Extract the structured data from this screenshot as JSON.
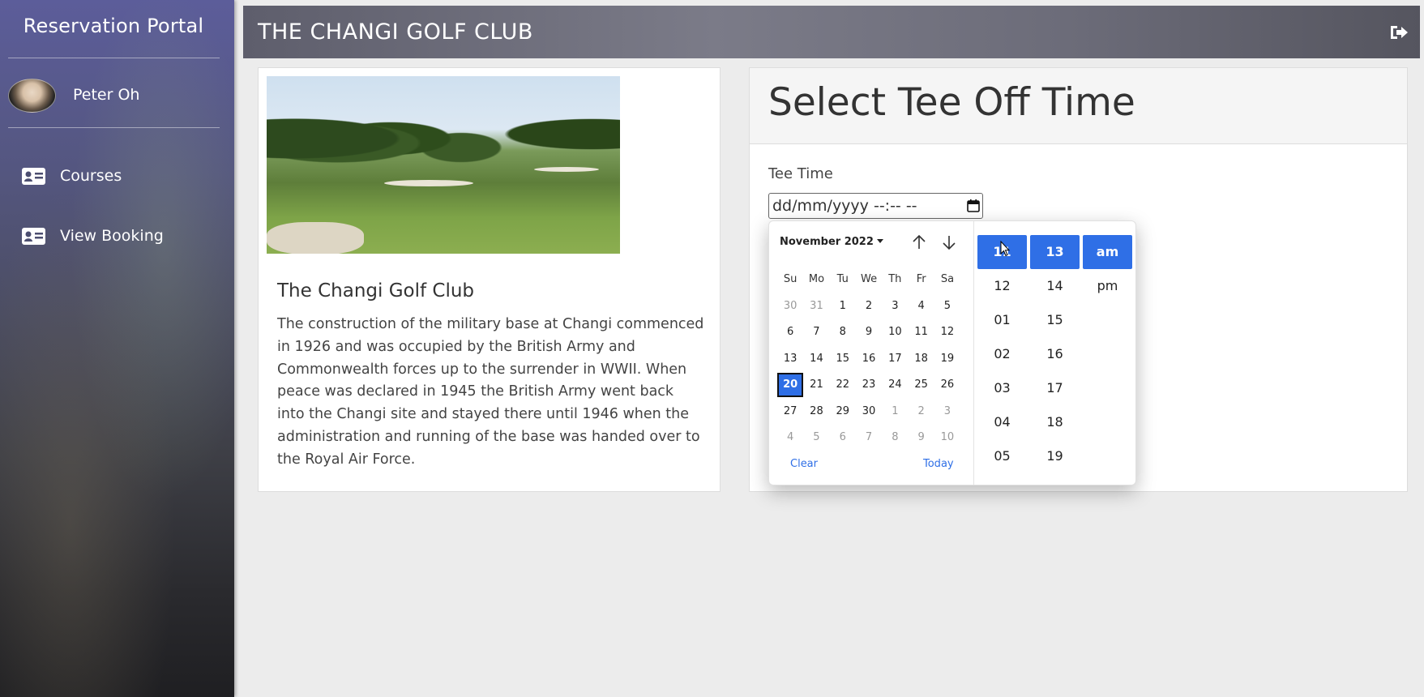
{
  "sidebar": {
    "brand": "Reservation Portal",
    "user": {
      "name": "Peter Oh"
    },
    "items": [
      {
        "label": "Courses",
        "icon": "id-card-icon"
      },
      {
        "label": "View Booking",
        "icon": "id-card-icon"
      }
    ]
  },
  "header": {
    "title": "THE CHANGI GOLF CLUB",
    "logout_icon": "sign-out-icon"
  },
  "course": {
    "name": "The Changi Golf Club",
    "description": "The construction of the military base at Changi commenced in 1926 and was occupied by the British Army and Commonwealth forces up to the surrender in WWII. When peace was declared in 1945 the British Army went back into the Changi site and stayed there until 1946 when the administration and running of the base was handed over to the Royal Air Force."
  },
  "booking": {
    "title": "Select Tee Off Time",
    "tee_time_label": "Tee Time",
    "input_value": "dd/mm/yyyy --:-- --"
  },
  "picker": {
    "month_label": "November 2022",
    "weekdays": [
      "Su",
      "Mo",
      "Tu",
      "We",
      "Th",
      "Fr",
      "Sa"
    ],
    "weeks": [
      [
        "30",
        "31",
        "1",
        "2",
        "3",
        "4",
        "5"
      ],
      [
        "6",
        "7",
        "8",
        "9",
        "10",
        "11",
        "12"
      ],
      [
        "13",
        "14",
        "15",
        "16",
        "17",
        "18",
        "19"
      ],
      [
        "20",
        "21",
        "22",
        "23",
        "24",
        "25",
        "26"
      ],
      [
        "27",
        "28",
        "29",
        "30",
        "1",
        "2",
        "3"
      ],
      [
        "4",
        "5",
        "6",
        "7",
        "8",
        "9",
        "10"
      ]
    ],
    "selected_day": "20",
    "clear_label": "Clear",
    "today_label": "Today",
    "hours": [
      "11",
      "12",
      "01",
      "02",
      "03",
      "04",
      "05"
    ],
    "minutes": [
      "13",
      "14",
      "15",
      "16",
      "17",
      "18",
      "19"
    ],
    "ampm": [
      "am",
      "pm"
    ],
    "selected_hour": "11",
    "selected_minute": "13",
    "selected_ampm": "am"
  },
  "colors": {
    "accent": "#2f6fe6",
    "link": "#2f6fe6"
  }
}
